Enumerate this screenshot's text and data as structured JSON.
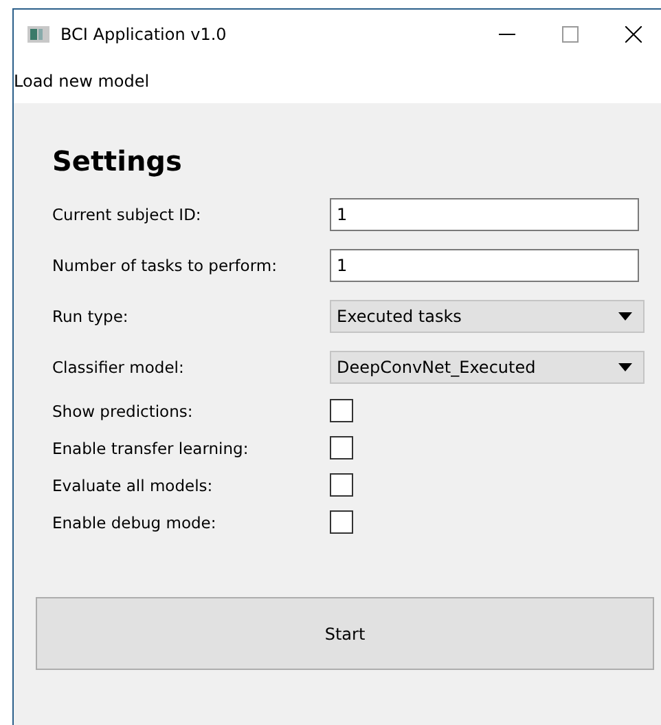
{
  "window": {
    "title": "BCI Application v1.0"
  },
  "menu": [
    "Load new model"
  ],
  "heading": "Settings",
  "rows": [
    {
      "kind": "field",
      "label": "Current subject ID:",
      "value": "1"
    },
    {
      "kind": "field",
      "label": "Number of tasks to perform:",
      "value": "1"
    },
    {
      "kind": "dropdown",
      "label": "Run type:",
      "value": "Executed tasks"
    },
    {
      "kind": "dropdown",
      "label": "Classifier model:",
      "value": "DeepConvNet_Executed"
    },
    {
      "kind": "checkbox",
      "label": "Show predictions:",
      "checked": false
    },
    {
      "kind": "checkbox",
      "label": "Enable transfer learning:",
      "checked": false
    },
    {
      "kind": "checkbox",
      "label": "Evaluate all models:",
      "checked": false
    },
    {
      "kind": "checkbox",
      "label": "Enable debug mode:",
      "checked": false
    }
  ],
  "start_button": "Start"
}
